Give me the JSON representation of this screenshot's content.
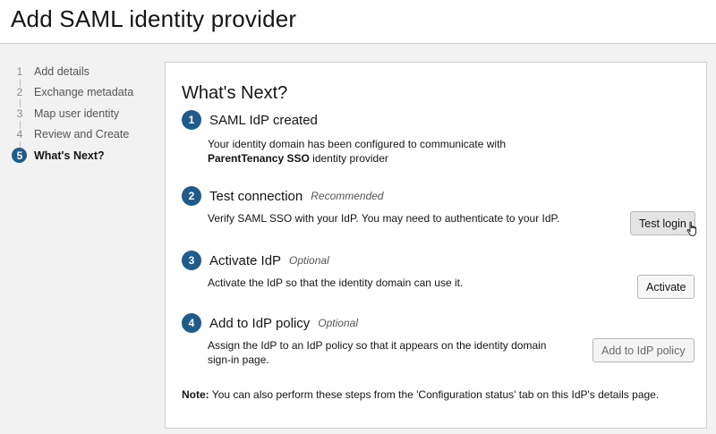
{
  "header": {
    "title": "Add SAML identity provider"
  },
  "train": {
    "steps": [
      {
        "num": "1",
        "label": "Add details"
      },
      {
        "num": "2",
        "label": "Exchange metadata"
      },
      {
        "num": "3",
        "label": "Map user identity"
      },
      {
        "num": "4",
        "label": "Review and Create"
      },
      {
        "num": "5",
        "label": "What's Next?"
      }
    ],
    "active_step": 5
  },
  "main": {
    "title": "What's Next?",
    "items": [
      {
        "num": "1",
        "title": "SAML IdP created",
        "desc_line1": "Your identity domain has been configured to communicate with",
        "desc_bold": "ParentTenancy SSO",
        "desc_tail": " identity provider"
      },
      {
        "num": "2",
        "title": "Test connection",
        "tag": "Recommended",
        "desc": "Verify SAML SSO with your IdP. You may need to authenticate to your IdP.",
        "button": "Test login"
      },
      {
        "num": "3",
        "title": "Activate IdP",
        "tag": "Optional",
        "desc": "Activate the IdP so that the identity domain can use it.",
        "button": "Activate"
      },
      {
        "num": "4",
        "title": "Add to IdP policy",
        "tag": "Optional",
        "desc": "Assign the IdP to an IdP policy so that it appears on the identity domain sign-in page.",
        "button": "Add to IdP policy"
      }
    ],
    "note_label": "Note:",
    "note_text": " You can also perform these steps from the 'Configuration status' tab on this IdP's details page."
  },
  "colors": {
    "accent": "#1f5c8c",
    "background": "#f2f2f2"
  }
}
